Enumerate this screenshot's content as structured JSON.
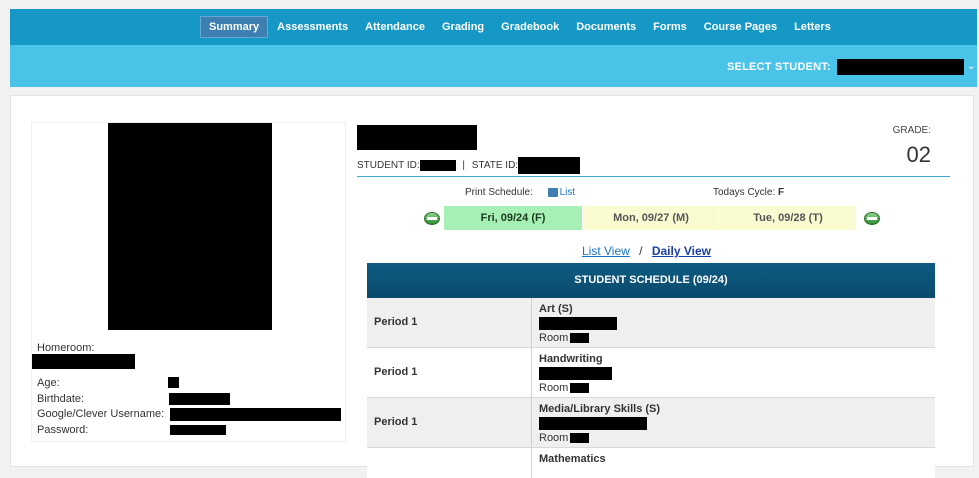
{
  "nav": {
    "items": [
      "Summary",
      "Assessments",
      "Attendance",
      "Grading",
      "Gradebook",
      "Documents",
      "Forms",
      "Course Pages",
      "Letters"
    ],
    "active": "Summary"
  },
  "student_selector": {
    "label": "SELECT STUDENT:"
  },
  "profile": {
    "homeroom_label": "Homeroom:",
    "age_label": "Age:",
    "birthdate_label": "Birthdate:",
    "username_label": "Google/Clever Username:",
    "password_label": "Password:",
    "student_id_label": "STUDENT ID:",
    "separator": "|",
    "state_id_label": "STATE ID:",
    "grade_label": "GRADE:",
    "grade_value": "02"
  },
  "schedule_nav": {
    "print_label": "Print Schedule:",
    "list_link": "List",
    "cycle_label": "Todays Cycle:",
    "cycle_value": "F",
    "days": [
      {
        "label": "Fri, 09/24 (F)",
        "selected": true
      },
      {
        "label": "Mon, 09/27 (M)",
        "selected": false
      },
      {
        "label": "Tue, 09/28 (T)",
        "selected": false
      }
    ],
    "list_view": "List View",
    "view_sep": "/",
    "daily_view": "Daily View"
  },
  "schedule": {
    "title": "STUDENT SCHEDULE (09/24)",
    "room_label": "Room",
    "rows": [
      {
        "period": "Period 1",
        "subject": "Art (S)"
      },
      {
        "period": "Period 1",
        "subject": "Handwriting"
      },
      {
        "period": "Period 1",
        "subject": "Media/Library Skills (S)"
      },
      {
        "period": "",
        "subject": "Mathematics"
      }
    ]
  },
  "colors": {
    "nav_bg": "#1698c6",
    "subbar_bg": "#4ac3e8",
    "schedule_header": "#0a4a6c",
    "selected_day": "#a6f0b6",
    "other_day": "#fbfbd2"
  }
}
